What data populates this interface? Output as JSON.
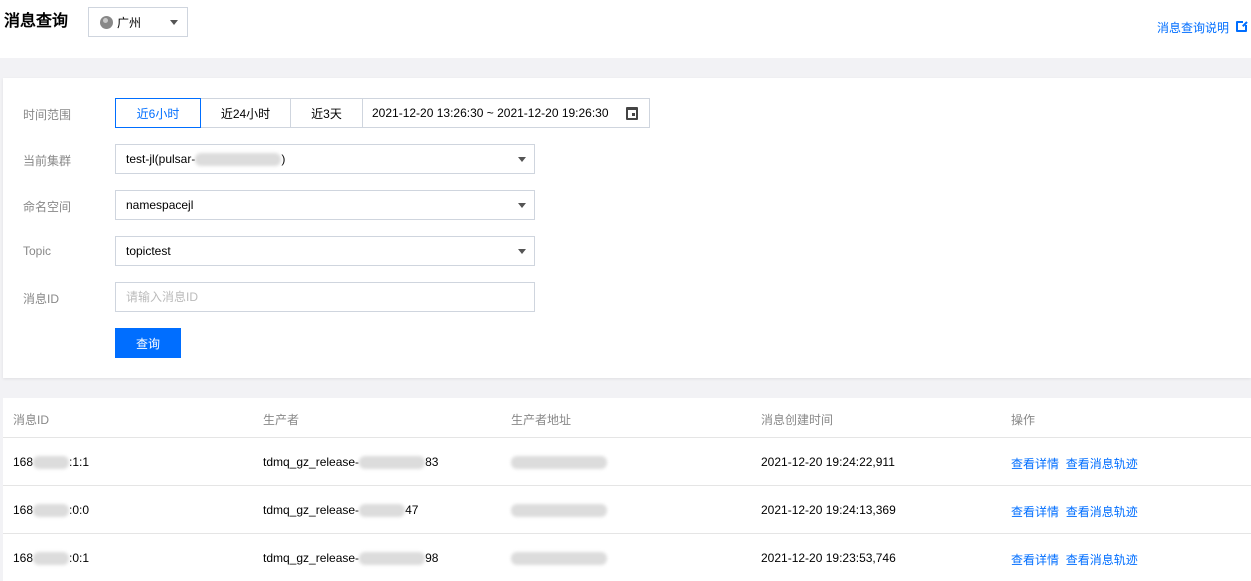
{
  "header": {
    "title": "消息查询",
    "region": "广州",
    "help_link": "消息查询说明"
  },
  "filters": {
    "time_range_label": "时间范围",
    "time_tabs": [
      "近6小时",
      "近24小时",
      "近3天"
    ],
    "date_range": "2021-12-20 13:26:30 ~ 2021-12-20 19:26:30",
    "cluster_label": "当前集群",
    "cluster_prefix": "test-jl(pulsar-",
    "cluster_suffix": ")",
    "namespace_label": "命名空间",
    "namespace_value": "namespacejl",
    "topic_label": "Topic",
    "topic_value": "topictest",
    "msgid_label": "消息ID",
    "msgid_placeholder": "请输入消息ID",
    "query_button": "查询"
  },
  "table": {
    "columns": [
      "消息ID",
      "生产者",
      "生产者地址",
      "消息创建时间",
      "操作"
    ],
    "rows": [
      {
        "id_prefix": "168",
        "id_suffix": ":1:1",
        "producer_prefix": "tdmq_gz_release-",
        "producer_suffix": "83",
        "created": "2021-12-20 19:24:22,911",
        "action_detail": "查看详情",
        "action_trace": "查看消息轨迹"
      },
      {
        "id_prefix": "168",
        "id_suffix": ":0:0",
        "producer_prefix": "tdmq_gz_release-",
        "producer_suffix": "47",
        "created": "2021-12-20 19:24:13,369",
        "action_detail": "查看详情",
        "action_trace": "查看消息轨迹"
      },
      {
        "id_prefix": "168",
        "id_suffix": ":0:1",
        "producer_prefix": "tdmq_gz_release-",
        "producer_suffix": "98",
        "created": "2021-12-20 19:23:53,746",
        "action_detail": "查看详情",
        "action_trace": "查看消息轨迹"
      }
    ]
  },
  "colors": {
    "accent": "#006eff",
    "label_gray": "#888888",
    "border": "#cfd5de",
    "page_bg": "#f2f2f5"
  },
  "icons": [
    "globe-icon",
    "chevron-down-icon",
    "external-link-icon",
    "calendar-icon"
  ]
}
